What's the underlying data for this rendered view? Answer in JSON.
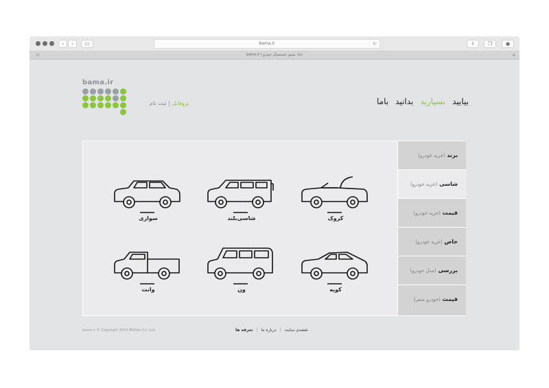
{
  "browser": {
    "url": "bama.ir",
    "tab_title": "bama.ir | باما؛ موتور جستجوگر خودرو",
    "back_icon": "chevron-left-icon",
    "forward_icon": "chevron-right-icon",
    "sidebar_icon": "sidebar-icon",
    "reload_icon": "reload-icon",
    "share_icon": "share-icon",
    "tabs_icon": "tabs-icon",
    "download_icon": "download-icon"
  },
  "header": {
    "logo_text": "bama.ir",
    "profile_link": "پروفایل",
    "signup_link": "ثبت نام",
    "profile_separator": "|",
    "nav": [
      {
        "label": "بیایید"
      },
      {
        "label": "بسپارید"
      },
      {
        "label": "بدانید"
      },
      {
        "label": "باما"
      }
    ],
    "active_nav": "بسپارید",
    "accent_color": "#8cc63f"
  },
  "cars": [
    {
      "label": "کروک",
      "icon": "convertible-car-icon"
    },
    {
      "label": "شاسی‌بلند",
      "icon": "suv-car-icon"
    },
    {
      "label": "سواری",
      "icon": "sedan-car-icon"
    },
    {
      "label": "کوپه",
      "icon": "coupe-car-icon"
    },
    {
      "label": "ون",
      "icon": "van-car-icon"
    },
    {
      "label": "وانت",
      "icon": "pickup-truck-icon"
    }
  ],
  "sidebar": {
    "items": [
      {
        "label": "برند",
        "sub": "(خرید خودرو)"
      },
      {
        "label": "شاسی",
        "sub": "(خرید خودرو)"
      },
      {
        "label": "قیمت",
        "sub": "(خرید خودرو)"
      },
      {
        "label": "خاص",
        "sub": "(خرید خودرو)"
      },
      {
        "label": "بررسی",
        "sub": "(مدل خودرو)"
      },
      {
        "label": "قیمت",
        "sub": "(خودرو صفر)"
      }
    ],
    "active_index": 1
  },
  "footer": {
    "copyright": "bama.ir © Copyright 2014 MGHan Co. Ltd.",
    "links": [
      "نقشه‌ی سایت",
      "درباره ما",
      "تعرفه ها"
    ],
    "separator": "|"
  }
}
